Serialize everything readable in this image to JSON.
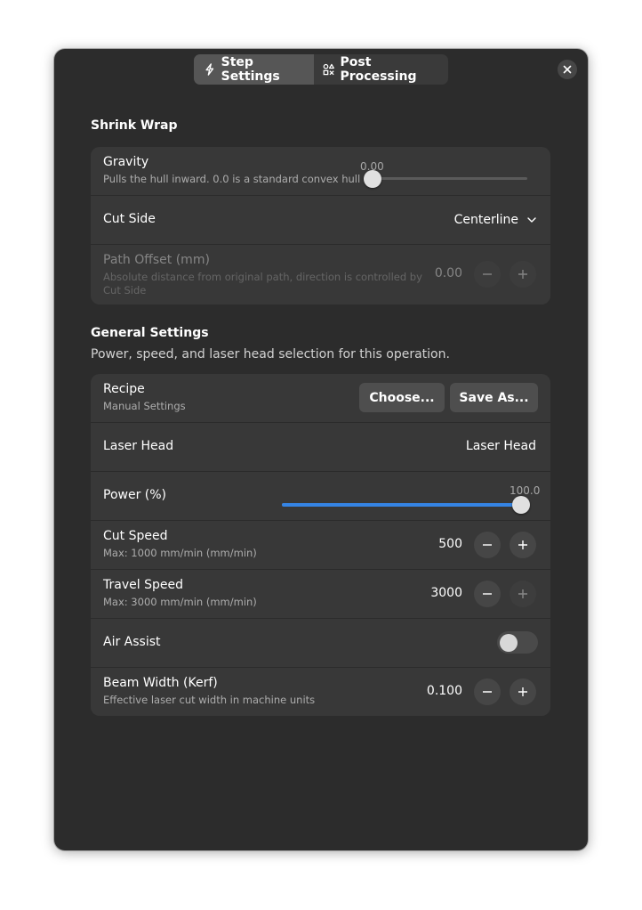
{
  "tabs": [
    {
      "label": "Step Settings",
      "icon": "lightning-icon",
      "active": true
    },
    {
      "label": "Post Processing",
      "icon": "shapes-icon",
      "active": false
    }
  ],
  "shrink_wrap": {
    "title": "Shrink Wrap",
    "gravity": {
      "label": "Gravity",
      "description": "Pulls the hull inward. 0.0 is a standard convex hull",
      "value": "0.00",
      "level": 0.0
    },
    "cut_side": {
      "label": "Cut Side",
      "selected": "Centerline"
    },
    "path_offset": {
      "label": "Path Offset (mm)",
      "description": "Absolute distance from original path, direction is controlled by Cut Side",
      "value": "0.00",
      "enabled": false
    }
  },
  "general": {
    "title": "General Settings",
    "description": "Power, speed, and laser head selection for this operation.",
    "recipe": {
      "label": "Recipe",
      "description": "Manual Settings",
      "choose_label": "Choose...",
      "save_label": "Save As..."
    },
    "laser_head": {
      "label": "Laser Head",
      "value": "Laser Head"
    },
    "power": {
      "label": "Power (%)",
      "value": "100.0",
      "level": 1.0
    },
    "cut_speed": {
      "label": "Cut Speed",
      "description": "Max: 1000 mm/min (mm/min)",
      "value": "500"
    },
    "travel_speed": {
      "label": "Travel Speed",
      "description": "Max: 3000 mm/min (mm/min)",
      "value": "3000"
    },
    "air_assist": {
      "label": "Air Assist",
      "enabled": false
    },
    "beam_width": {
      "label": "Beam Width (Kerf)",
      "description": "Effective laser cut width in machine units",
      "value": "0.100"
    }
  },
  "colors": {
    "accent": "#3584e4",
    "window_bg": "#2c2c2c",
    "card_bg": "#383838"
  }
}
